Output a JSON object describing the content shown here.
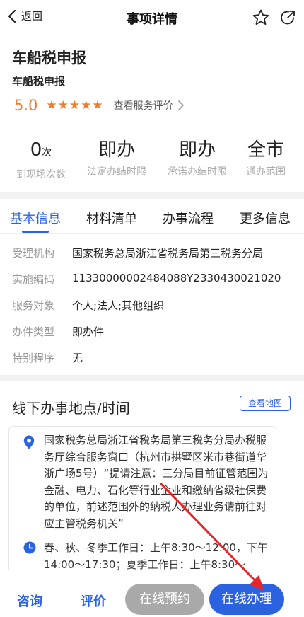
{
  "nav": {
    "back_label": "返回",
    "title": "事项详情",
    "icons": [
      "star-icon",
      "share-icon"
    ]
  },
  "item": {
    "title": "车船税申报",
    "subtitle": "车船税申报",
    "score": "5.0",
    "stars": 5,
    "review_link": "查看服务评价"
  },
  "stats": [
    {
      "value": "0",
      "unit": "次",
      "label": "到现场次数"
    },
    {
      "value": "即办",
      "unit": "",
      "label": "法定办结时限"
    },
    {
      "value": "即办",
      "unit": "",
      "label": "承诺办结时限"
    },
    {
      "value": "全市",
      "unit": "",
      "label": "通办范围"
    }
  ],
  "tabs": [
    {
      "label": "基本信息",
      "active": true
    },
    {
      "label": "材料清单",
      "active": false
    },
    {
      "label": "办事流程",
      "active": false
    },
    {
      "label": "更多信息",
      "active": false
    }
  ],
  "info": [
    {
      "key": "受理机构",
      "value": "国家税务总局浙江省税务局第三税务分局"
    },
    {
      "key": "实施编码",
      "value": "11330000002484088Y2330430021020"
    },
    {
      "key": "服务对象",
      "value": "个人;法人;其他组织"
    },
    {
      "key": "办件类型",
      "value": "即办件"
    },
    {
      "key": "特别程序",
      "value": "无"
    }
  ],
  "offline": {
    "title": "线下办事地点/时间",
    "map_button": "查看地图",
    "address": "国家税务总局浙江省税务局第三税务分局办税服务厅综合服务窗口（杭州市拱墅区米市巷街道华浙广场5号）“提请注意：三分局目前征管范围为金融、电力、石化等行业企业和缴纳省级社保费的单位，前述范围外的纳税人办理业务请前往对应主管税务机关”",
    "hours": "春、秋、冬季工作日：上午8:30～12:00，下午14:00～17:30；夏季工作日：上午8:30～"
  },
  "bottom": {
    "consult": "咨询",
    "review": "评价",
    "reserve": "在线预约",
    "apply": "在线办理"
  },
  "colors": {
    "accent": "#2b62e0",
    "star": "#f07a2e",
    "disabled": "#a9a9a9",
    "annotation_arrow": "#e8242a"
  }
}
